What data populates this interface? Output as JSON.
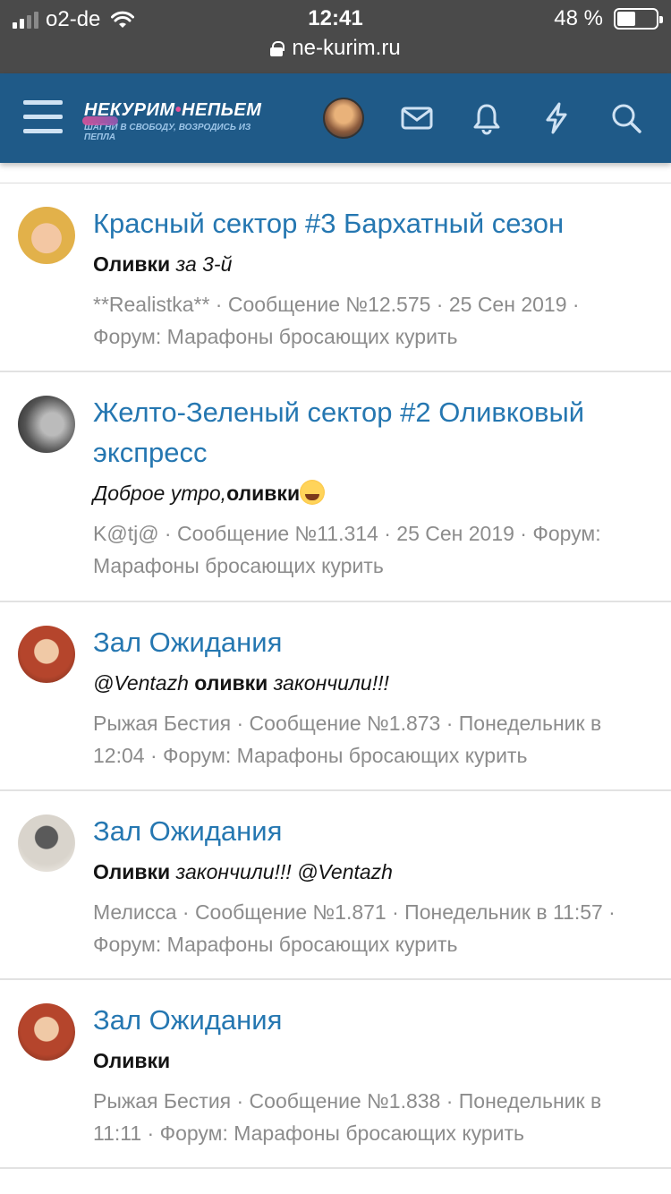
{
  "status_bar": {
    "carrier": "o2-de",
    "time": "12:41",
    "battery_text": "48 %",
    "battery_level": 0.48,
    "url": "ne-kurim.ru"
  },
  "header": {
    "logo_title_left": "НЕКУРИМ",
    "logo_dot": "•",
    "logo_title_right": "НЕПЬЕМ",
    "logo_subtitle": "ШАГНИ В СВОБОДУ, ВОЗРОДИСЬ ИЗ ПЕПЛА",
    "icons": [
      "menu-icon",
      "avatar",
      "envelope-icon",
      "bell-icon",
      "lightning-icon",
      "search-icon"
    ]
  },
  "results": [
    {
      "title": "Красный сектор #3 Бархатный сезон",
      "snippet_pre": "",
      "snippet_bold": "Оливки",
      "snippet_post": " за 3-й",
      "meta": "**Realistka** · Сообщение №12.575 · 25 Сен 2019 · Форум: Марафоны бросающих курить"
    },
    {
      "title": "Желто-Зеленый сектор #2 Оливковый экспресс",
      "snippet_pre": "Доброе утро,",
      "snippet_bold": "оливки",
      "snippet_post": "",
      "meta": "K@tj@ · Сообщение №11.314 · 25 Сен 2019 · Форум: Марафоны бросающих курить"
    },
    {
      "title": "Зал Ожидания",
      "snippet_pre": "@Ventazh ",
      "snippet_bold": "оливки",
      "snippet_post": " закончили!!!",
      "meta": "Рыжая Бестия · Сообщение №1.873 · Понедельник в 12:04 · Форум: Марафоны бросающих курить"
    },
    {
      "title": "Зал Ожидания",
      "snippet_pre": "",
      "snippet_bold": "Оливки",
      "snippet_post": " закончили!!! @Ventazh",
      "meta": "Мелисса · Сообщение №1.871 · Понедельник в 11:57 · Форум: Марафоны бросающих курить"
    },
    {
      "title": "Зал Ожидания",
      "snippet_pre": "",
      "snippet_bold": "Оливки",
      "snippet_post": "",
      "meta": "Рыжая Бестия · Сообщение №1.838 · Понедельник в 11:11 · Форум: Марафоны бросающих курить"
    }
  ]
}
